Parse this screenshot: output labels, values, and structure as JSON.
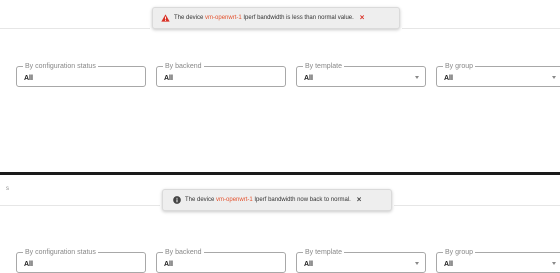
{
  "notifications": {
    "warning": {
      "prefix": "The device",
      "device": "vm-openwrt-1",
      "suffix": "Iperf bandwidth is less than normal value.",
      "icon": "warning-icon",
      "color": "#d93025"
    },
    "info": {
      "prefix": "The device",
      "device": "vm-openwrt-1",
      "suffix": "Iperf bandwidth now back to normal.",
      "icon": "info-icon",
      "color": "#444444"
    },
    "close_glyph": "×"
  },
  "filters": [
    {
      "label": "By configuration status",
      "value": "All",
      "has_caret": false
    },
    {
      "label": "By backend",
      "value": "All",
      "has_caret": false
    },
    {
      "label": "By template",
      "value": "All",
      "has_caret": true
    },
    {
      "label": "By group",
      "value": "All",
      "has_caret": true
    }
  ],
  "edge_text": "s",
  "colors": {
    "device_link": "#e4532f",
    "warning": "#d93025",
    "toast_bg": "#eeeeee"
  }
}
